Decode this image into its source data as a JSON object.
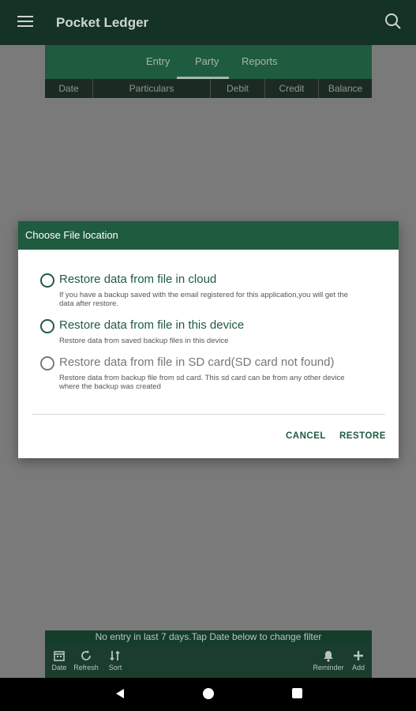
{
  "app": {
    "title": "Pocket Ledger"
  },
  "tabs": [
    "Entry",
    "Party",
    "Reports"
  ],
  "columns": [
    "Date",
    "Particulars",
    "Debit",
    "Credit",
    "Balance"
  ],
  "dialog": {
    "title": "Choose File location",
    "options": [
      {
        "label": "Restore data from file in cloud",
        "description": "If you have a backup saved with the email registered for this application,you will get the data after restore."
      },
      {
        "label": "Restore data from file in this device",
        "description": "Restore data from saved backup files in this device"
      },
      {
        "label": "Restore data from file in SD card(SD card not found)",
        "description": "Restore data from backup file from sd card. This sd card can be from any other device where the backup was created"
      }
    ],
    "cancel": "CANCEL",
    "restore": "RESTORE"
  },
  "filter_message": "No entry in last 7 days.Tap Date below to change filter",
  "toolbar": [
    "Date",
    "Refresh",
    "Sort",
    "Reminder",
    "Add"
  ],
  "colors": {
    "primary": "#1f5b3f",
    "appbar": "#143225"
  }
}
